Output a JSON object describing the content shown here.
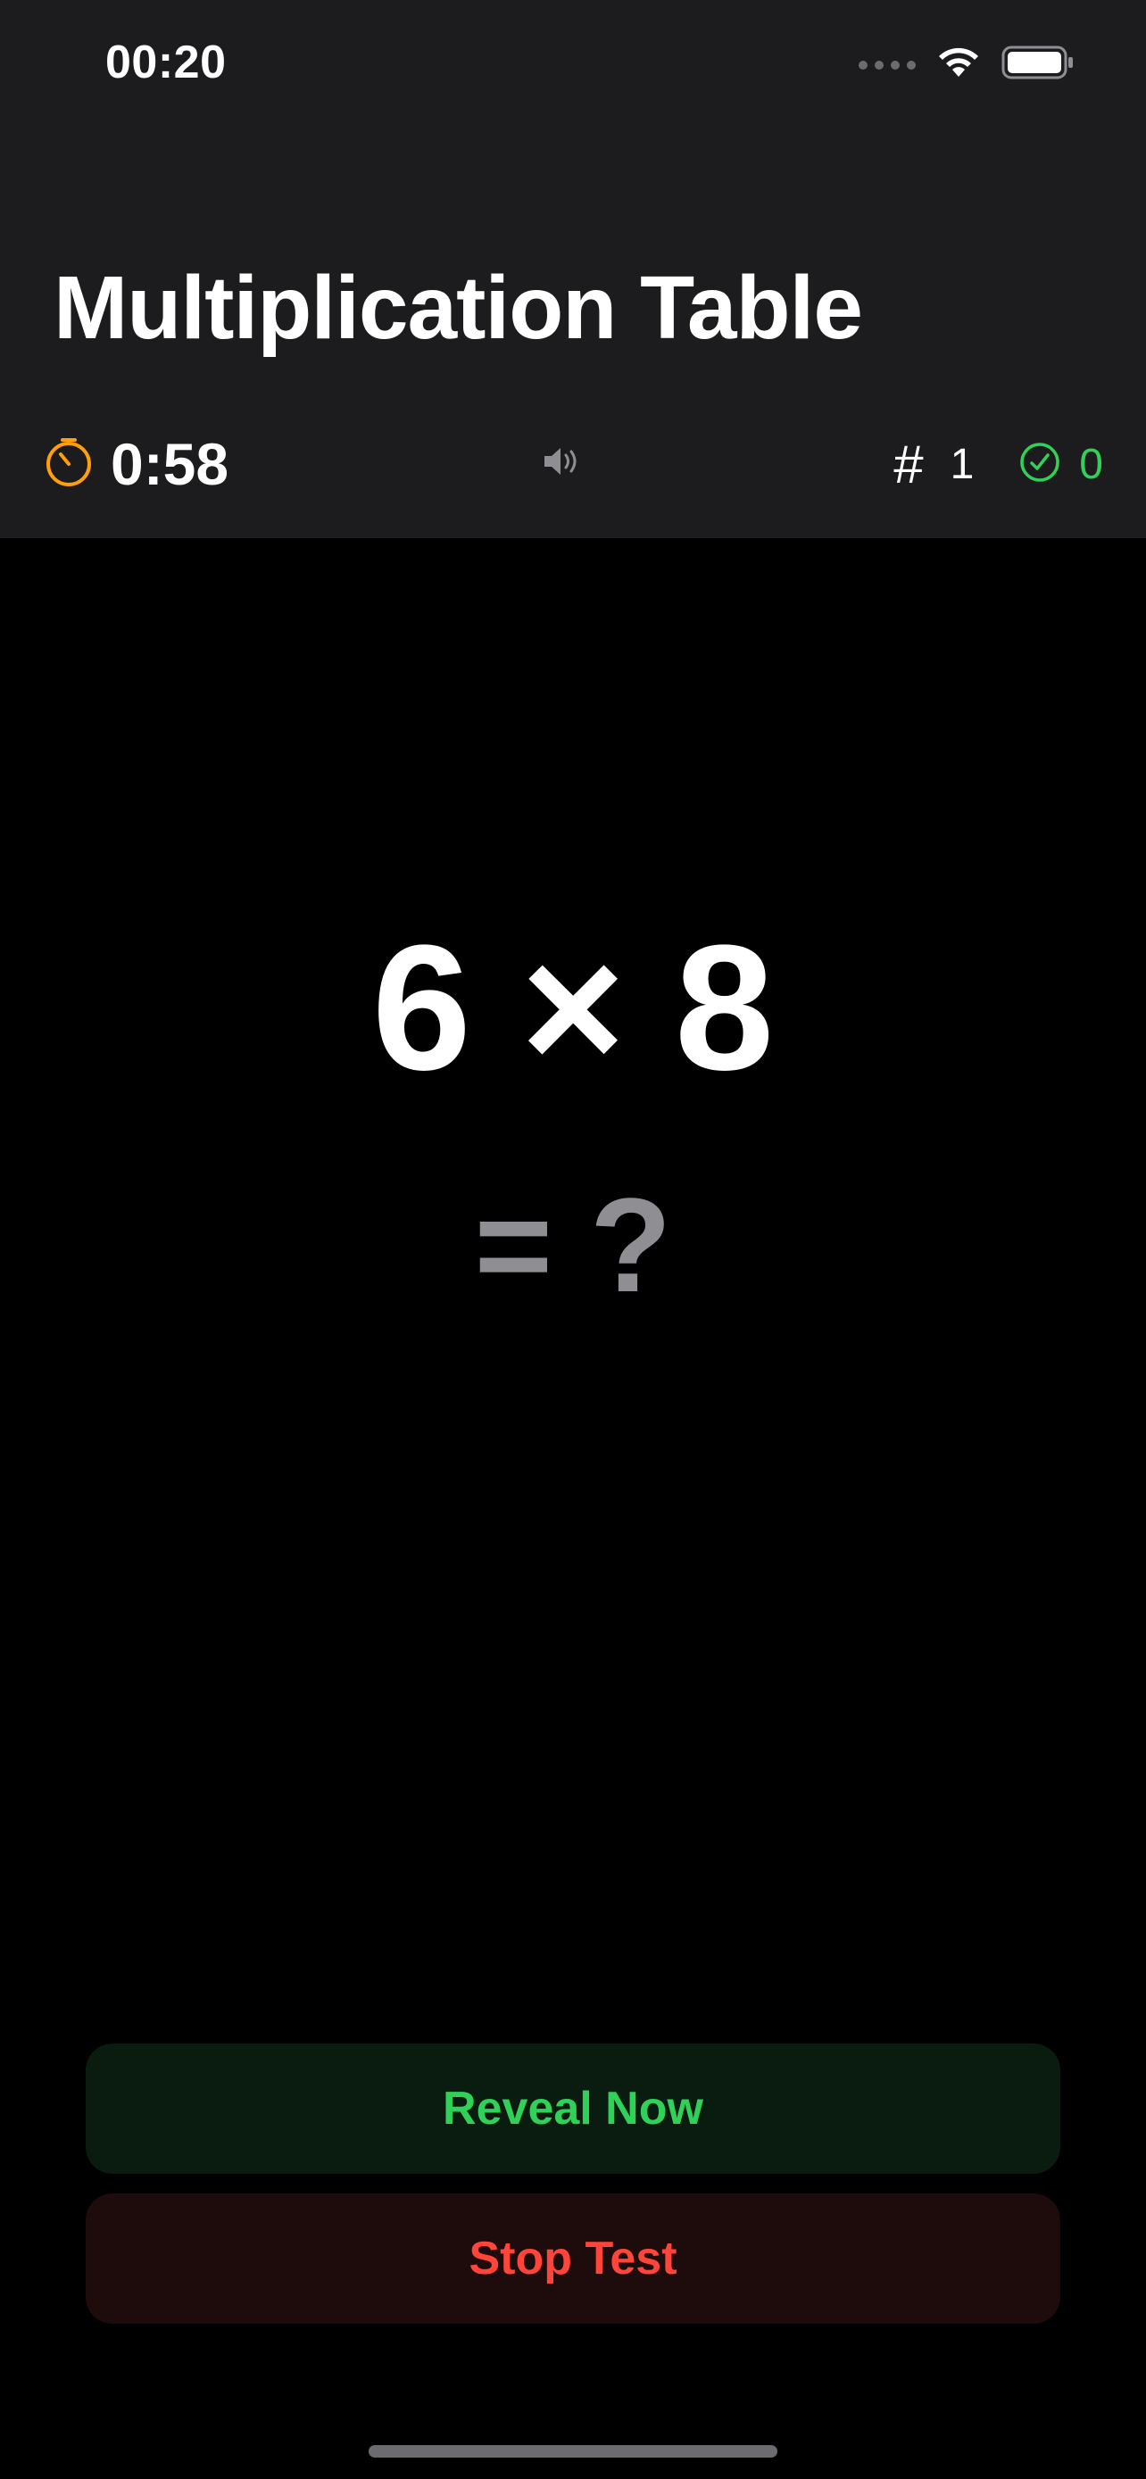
{
  "status_bar": {
    "time": "00:20"
  },
  "header": {
    "title": "Multiplication Table"
  },
  "toolbar": {
    "timer": "0:58",
    "hash_symbol": "#",
    "question_number": "1",
    "correct_count": "0",
    "timer_icon": "stopwatch-icon",
    "sound_icon": "speaker-icon",
    "correct_icon": "checkmark-circle-icon"
  },
  "problem": {
    "expression": "6 × 8",
    "answer_placeholder": "= ?"
  },
  "actions": {
    "reveal_label": "Reveal Now",
    "stop_label": "Stop Test"
  },
  "colors": {
    "header_bg": "#1c1c1e",
    "accent_orange": "#ff9f0a",
    "accent_green": "#30d158",
    "accent_red": "#ff453a",
    "muted_gray": "#8e8e93"
  }
}
